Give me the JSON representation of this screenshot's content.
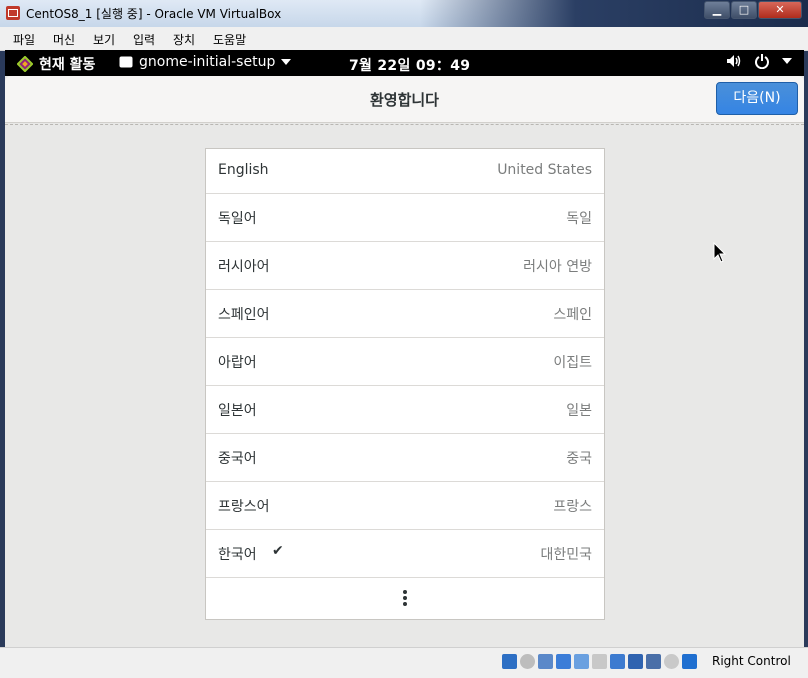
{
  "window": {
    "title": "CentOS8_1 [실행 중] - Oracle VM VirtualBox",
    "controls": {
      "minimize": "▁",
      "maximize": "□",
      "close": "✕"
    }
  },
  "menubar": {
    "items": [
      "파일",
      "머신",
      "보기",
      "입력",
      "장치",
      "도움말"
    ]
  },
  "gnome_topbar": {
    "activities": "현재 활동",
    "app_menu": "gnome-initial-setup",
    "clock": "7월 22일  09：49"
  },
  "header": {
    "title": "환영합니다",
    "next_button": "다음(N)"
  },
  "languages": [
    {
      "lang": "English",
      "region": "United States",
      "selected": false
    },
    {
      "lang": "독일어",
      "region": "독일",
      "selected": false
    },
    {
      "lang": "러시아어",
      "region": "러시아 연방",
      "selected": false
    },
    {
      "lang": "스페인어",
      "region": "스페인",
      "selected": false
    },
    {
      "lang": "아랍어",
      "region": "이집트",
      "selected": false
    },
    {
      "lang": "일본어",
      "region": "일본",
      "selected": false
    },
    {
      "lang": "중국어",
      "region": "중국",
      "selected": false
    },
    {
      "lang": "프랑스어",
      "region": "프랑스",
      "selected": false
    },
    {
      "lang": "한국어",
      "region": "대한민국",
      "selected": true
    }
  ],
  "check_glyph": "✔",
  "statusbar": {
    "host_key": "Right Control",
    "icons": [
      "hard-disk-icon",
      "optical-drive-icon",
      "audio-icon",
      "network-icon",
      "usb-icon",
      "shared-folders-icon",
      "display-icon",
      "video-capture-icon",
      "recording-icon",
      "mouse-integration-icon",
      "keyboard-icon"
    ]
  },
  "colors": {
    "accent": "#3584e4",
    "topbar": "#000000",
    "background": "#e8e8e7"
  }
}
